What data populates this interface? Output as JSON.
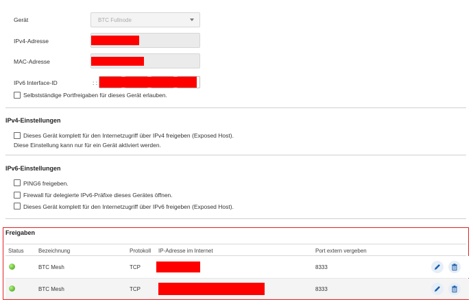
{
  "device": {
    "geraet_label": "Gerät",
    "geraet_value": "BTC Fullnode",
    "ipv4_label": "IPv4-Adresse",
    "mac_label": "MAC-Adresse",
    "ipv6_label": "IPv6 Interface-ID",
    "ipv6_prefix": ": :",
    "selfport_label": "Selbstständige Portfreigaben für dieses Gerät erlauben."
  },
  "ipv4": {
    "title": "IPv4-Einstellungen",
    "exposed_label": "Dieses Gerät komplett für den Internetzugriff über IPv4 freigeben (Exposed Host).",
    "note": "Diese Einstellung kann nur für ein Gerät aktiviert werden."
  },
  "ipv6": {
    "title": "IPv6-Einstellungen",
    "ping6_label": "PING6 freigeben.",
    "firewall_label": "Firewall für delegierte IPv6-Präfixe dieses Gerätes öffnen.",
    "exposed_label": "Dieses Gerät komplett für den Internetzugriff über IPv6 freigeben (Exposed Host)."
  },
  "freigaben": {
    "title": "Freigaben",
    "headers": [
      "Status",
      "Bezeichnung",
      "Protokoll",
      "IP-Adresse im Internet",
      "Port extern vergeben"
    ],
    "rows": [
      {
        "status": "active",
        "name": "BTC Mesh",
        "protocol": "TCP",
        "port": "8333"
      },
      {
        "status": "active",
        "name": "BTC Mesh",
        "protocol": "TCP",
        "port": "8333"
      }
    ]
  },
  "colors": {
    "redaction": "#ff0000",
    "status_ok": "#6cc23a",
    "accent": "#1a5fa8"
  },
  "icons": {
    "edit": "pencil-icon",
    "delete": "trash-icon",
    "dropdown": "chevron-down-icon"
  }
}
